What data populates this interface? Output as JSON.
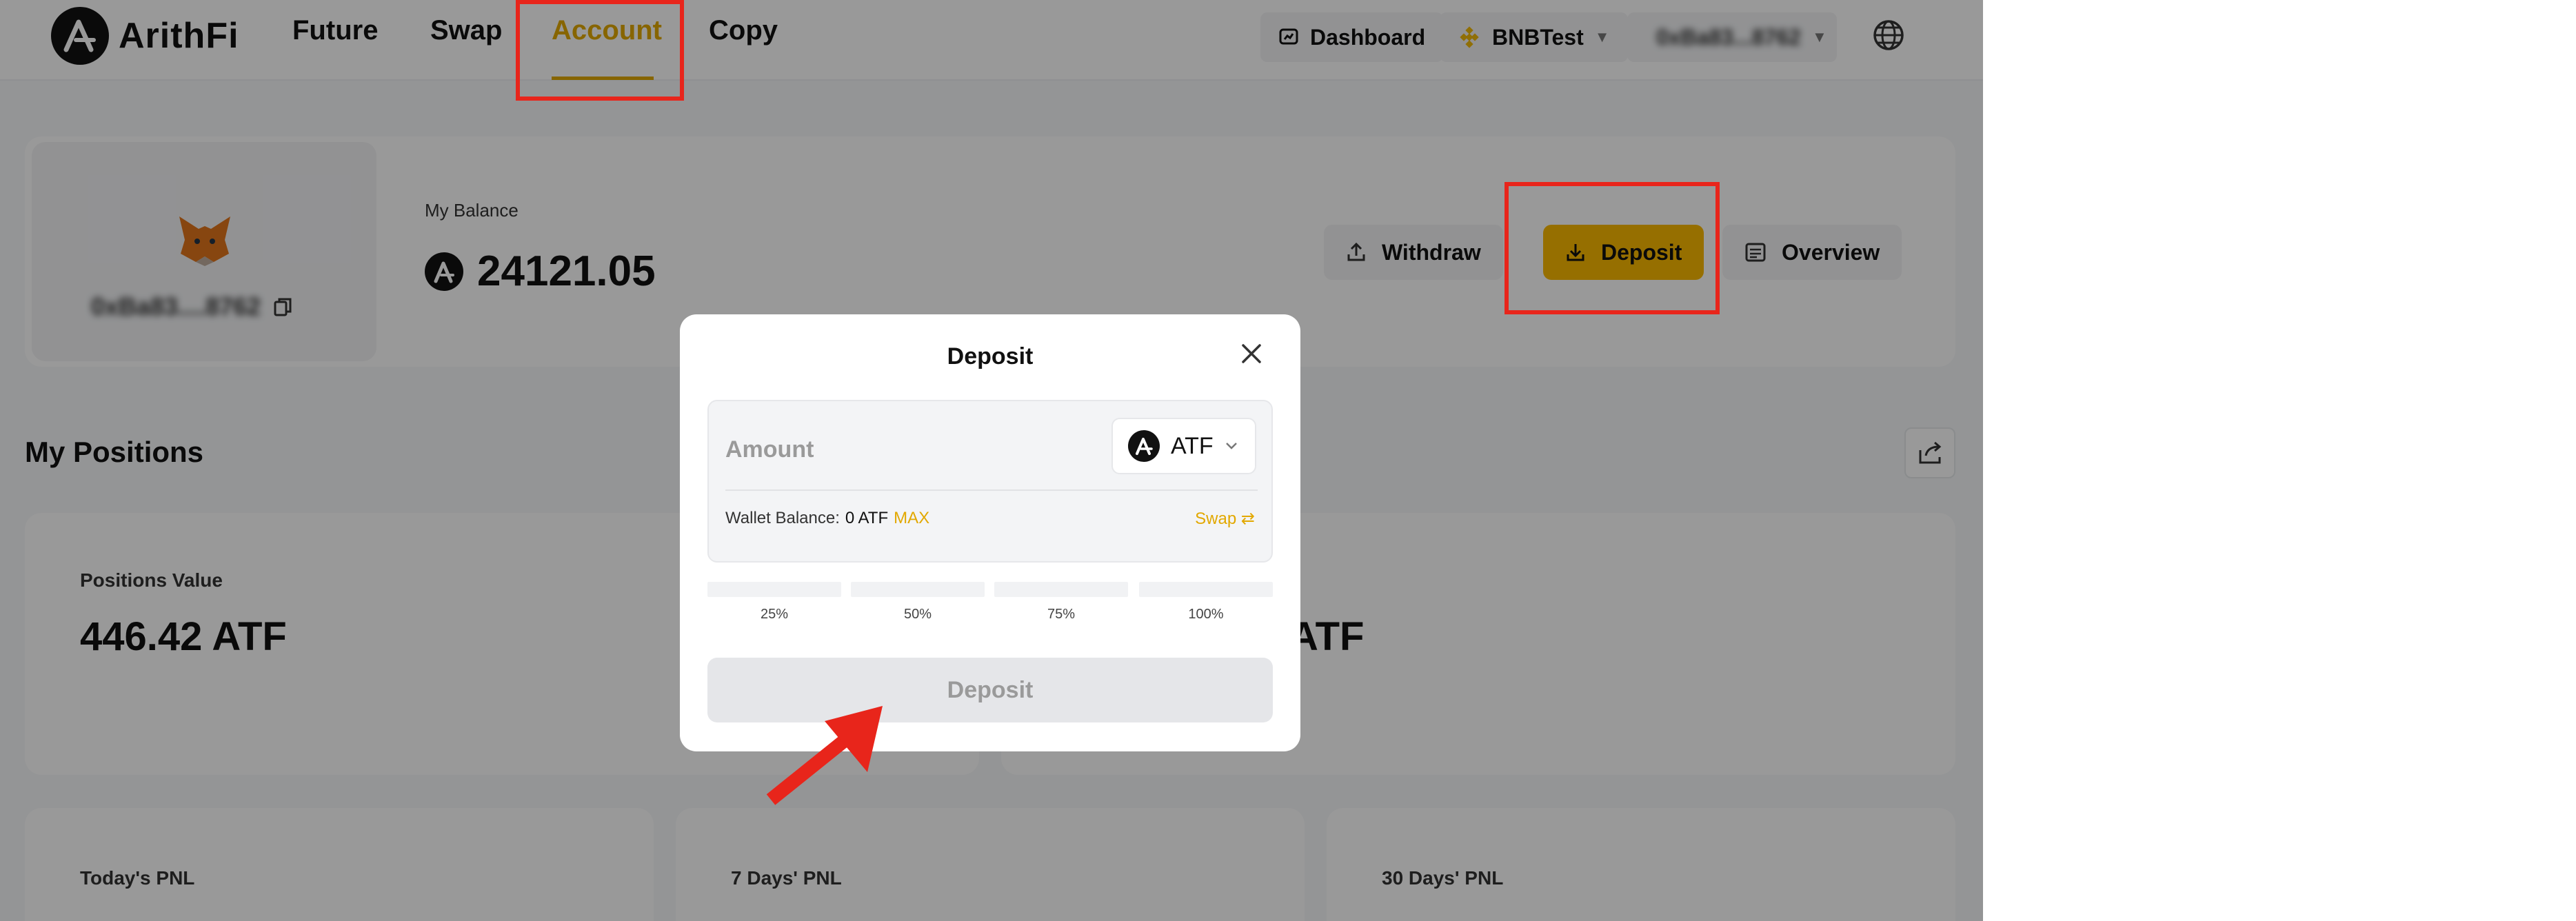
{
  "nav": {
    "logo_text": "ArithFi",
    "links": [
      "Future",
      "Swap",
      "Account",
      "Copy"
    ],
    "dashboard_label": "Dashboard",
    "network_label": "BNBTest",
    "wallet_label": "0xBa83...8762"
  },
  "account": {
    "address": "0xBa83....8762",
    "balance_label": "My Balance",
    "balance_value": "24121.05",
    "withdraw_label": "Withdraw",
    "deposit_label": "Deposit",
    "overview_label": "Overview"
  },
  "positions": {
    "title": "My Positions",
    "value_label": "Positions Value",
    "value": "446.42 ATF",
    "second_value_partial": "ATF",
    "todays_pnl_label": "Today's PNL",
    "seven_days_pnl_label": "7 Days' PNL",
    "thirty_days_pnl_label": "30 Days' PNL"
  },
  "modal": {
    "title": "Deposit",
    "amount_placeholder": "Amount",
    "token": "ATF",
    "wallet_balance_label": "Wallet Balance:",
    "wallet_balance_value": "0 ATF",
    "max_label": "MAX",
    "swap_label": "Swap",
    "percent_options": [
      "25%",
      "50%",
      "75%",
      "100%"
    ],
    "deposit_button_label": "Deposit"
  },
  "colors": {
    "accent": "#e2a800",
    "deposit_button": "#fbba00",
    "highlight_border": "#e8251b",
    "overlay": "rgba(0,0,0,0.40)"
  }
}
